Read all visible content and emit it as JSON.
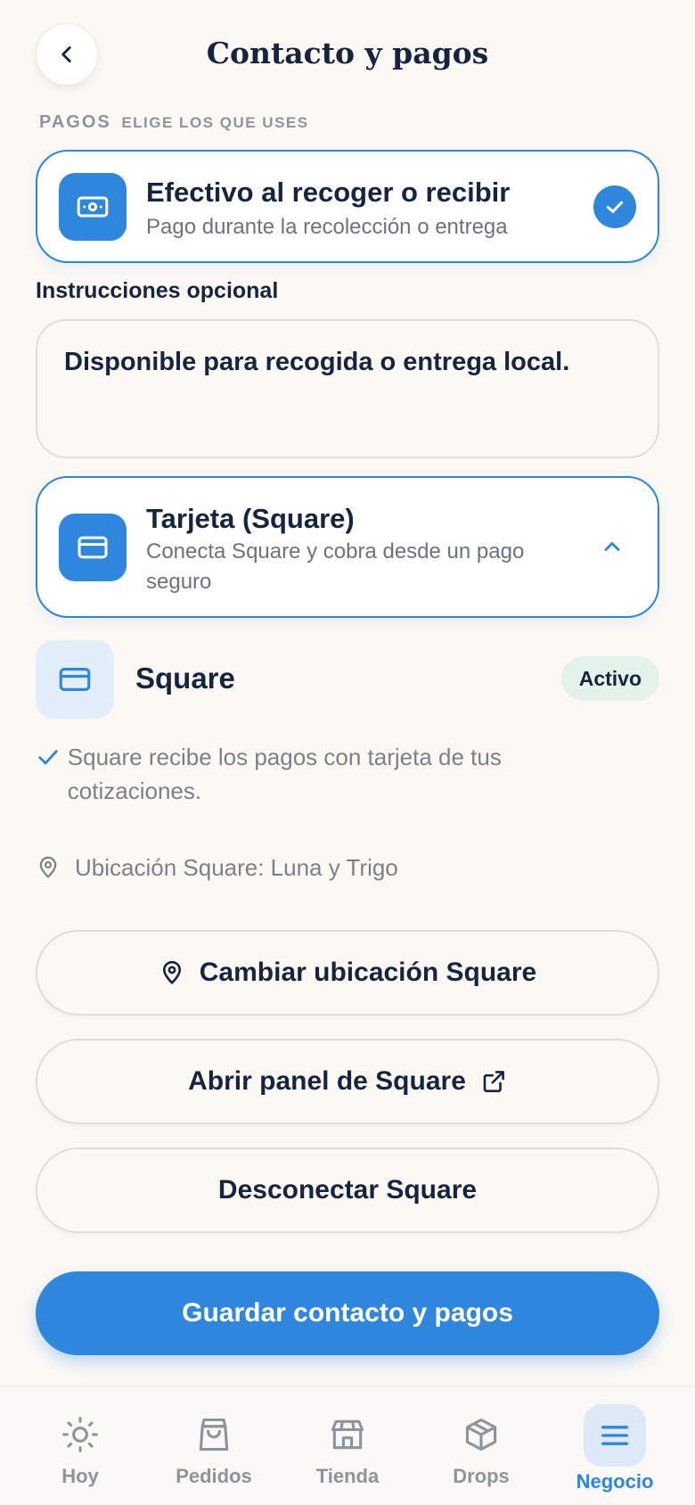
{
  "header": {
    "title": "Contacto y pagos",
    "back_icon": "chevron-left-icon"
  },
  "section": {
    "label": "PAGOS",
    "sublabel": "ELIGE LOS QUE USES"
  },
  "cash": {
    "title": "Efectivo al recoger o recibir",
    "subtitle": "Pago durante la recolección o entrega",
    "icon": "cash-icon",
    "selected": true
  },
  "instructions": {
    "label": "Instrucciones opcional",
    "value": "Disponible para recogida o entrega local."
  },
  "card": {
    "title": "Tarjeta (Square)",
    "subtitle": "Conecta Square y cobra desde un pago seguro",
    "icon": "credit-card-icon",
    "expanded": true
  },
  "square": {
    "name": "Square",
    "status": "Activo",
    "info": "Square recibe los pagos con tarjeta de tus cotizaciones.",
    "location": "Ubicación Square: Luna y Trigo",
    "change_location_label": "Cambiar ubicación Square",
    "open_panel_label": "Abrir panel de Square",
    "disconnect_label": "Desconectar Square"
  },
  "save_label": "Guardar contacto y pagos",
  "nav": {
    "items": [
      {
        "label": "Hoy",
        "icon": "sun-icon"
      },
      {
        "label": "Pedidos",
        "icon": "shopping-bag-icon"
      },
      {
        "label": "Tienda",
        "icon": "store-icon"
      },
      {
        "label": "Drops",
        "icon": "box-icon"
      },
      {
        "label": "Negocio",
        "icon": "menu-icon"
      }
    ],
    "active": "Negocio"
  },
  "colors": {
    "accent": "#2f86dd",
    "text": "#16253f",
    "muted": "#8e949c",
    "badge_bg": "#e3f3ea",
    "background": "#fcf9f5"
  }
}
